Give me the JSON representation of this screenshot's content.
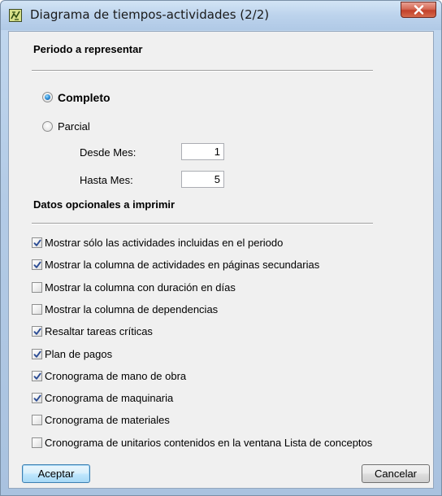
{
  "window": {
    "title": "Diagrama de tiempos-actividades (2/2)"
  },
  "periodo": {
    "section_title": "Periodo a representar",
    "completo_label": "Completo",
    "parcial_label": "Parcial",
    "selected": "Completo",
    "desde_label": "Desde Mes:",
    "desde_value": "1",
    "hasta_label": "Hasta Mes:",
    "hasta_value": "5"
  },
  "opcionales": {
    "section_title": "Datos opcionales a imprimir",
    "items": [
      {
        "label": "Mostrar sólo las actividades incluidas en el periodo",
        "checked": true
      },
      {
        "label": "Mostrar la columna de actividades en páginas secundarias",
        "checked": true
      },
      {
        "label": "Mostrar la columna con duración en días",
        "checked": false
      },
      {
        "label": "Mostrar la columna de dependencias",
        "checked": false
      },
      {
        "label": "Resaltar tareas críticas",
        "checked": true
      },
      {
        "label": "Plan de pagos",
        "checked": true
      },
      {
        "label": "Cronograma de mano de obra",
        "checked": true
      },
      {
        "label": "Cronograma de maquinaria",
        "checked": true
      },
      {
        "label": "Cronograma de materiales",
        "checked": false
      },
      {
        "label": "Cronograma de unitarios contenidos en la ventana Lista de conceptos",
        "checked": false
      }
    ]
  },
  "buttons": {
    "accept": "Aceptar",
    "cancel": "Cancelar"
  },
  "icons": {
    "app": "gantt-app-icon",
    "close": "close-icon",
    "check": "check-icon"
  },
  "colors": {
    "accent": "#2a8ad4",
    "close_button": "#c2412a",
    "dialog_background": "#f0f0f0"
  }
}
